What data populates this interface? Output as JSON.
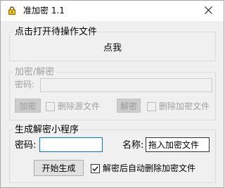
{
  "window": {
    "title": "准加密 1.1",
    "icon": "lock-icon"
  },
  "file_section": {
    "title": "点击打开待操作文件",
    "click_label": "点我"
  },
  "encrypt_section": {
    "title": "加密/解密",
    "password_label": "密码:",
    "password_value": "",
    "encrypt_button": "加密",
    "delete_source_label": "删除源文件",
    "delete_source_checked": false,
    "decrypt_button": "解密",
    "delete_encrypted_label": "删除加密文件",
    "delete_encrypted_checked": false,
    "enabled": false
  },
  "generator_section": {
    "title": "生成解密小程序",
    "password_label": "密码:",
    "password_value": "",
    "name_label": "名称:",
    "name_value": "拖入加密文件",
    "start_button": "开始生成",
    "auto_delete_label": "解密后自动删除加密文件",
    "auto_delete_checked": true
  }
}
